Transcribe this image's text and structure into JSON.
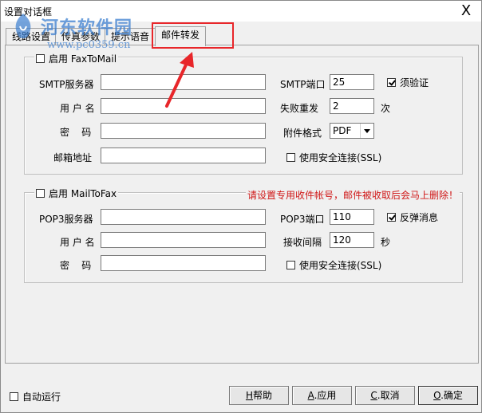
{
  "window": {
    "title": "设置对话框",
    "close_glyph": "X"
  },
  "watermark": {
    "text": "河东软件园",
    "url": "www.pc0359.cn"
  },
  "tabs": [
    {
      "label": "线路设置"
    },
    {
      "label": "传真参数"
    },
    {
      "label": "提示语音"
    },
    {
      "label": "邮件转发"
    }
  ],
  "fax_to_mail": {
    "enable_label": "启用 FaxToMail",
    "enabled": false,
    "smtp_server_label": "SMTP服务器",
    "smtp_server_value": "",
    "username_label": "用 户 名",
    "username_value": "",
    "password_label": "密    码",
    "password_value": "",
    "email_label": "邮箱地址",
    "email_value": "",
    "smtp_port_label": "SMTP端口",
    "smtp_port_value": "25",
    "require_auth_label": "须验证",
    "require_auth_checked": true,
    "retry_label": "失败重发",
    "retry_value": "2",
    "retry_unit": "次",
    "attachment_label": "附件格式",
    "attachment_value": "PDF",
    "ssl_label": "使用安全连接(SSL)",
    "ssl_checked": false
  },
  "mail_to_fax": {
    "enable_label": "启用 MailToFax",
    "enabled": false,
    "warning": "请设置专用收件帐号，邮件被收取后会马上删除！",
    "pop3_server_label": "POP3服务器",
    "pop3_server_value": "",
    "username_label": "用 户 名",
    "username_value": "",
    "password_label": "密    码",
    "password_value": "",
    "pop3_port_label": "POP3端口",
    "pop3_port_value": "110",
    "popup_label": "反弹消息",
    "popup_checked": true,
    "interval_label": "接收间隔",
    "interval_value": "120",
    "interval_unit": "秒",
    "ssl_label": "使用安全连接(SSL)",
    "ssl_checked": false
  },
  "footer": {
    "auto_run_label": "自动运行",
    "auto_run_checked": false,
    "help_key": "H",
    "help_label": "帮助",
    "apply_key": "A",
    "apply_label": ".应用",
    "cancel_key": "C",
    "cancel_label": ".取消",
    "ok_key": "O",
    "ok_label": ".确定"
  },
  "colors": {
    "highlight": "#e8262a",
    "warning": "#d01818",
    "watermark": "#3c7fd0"
  },
  "icons": {
    "close": "close-icon",
    "arrow": "red-arrow-annotation",
    "dropdown": "chevron-down-icon"
  }
}
